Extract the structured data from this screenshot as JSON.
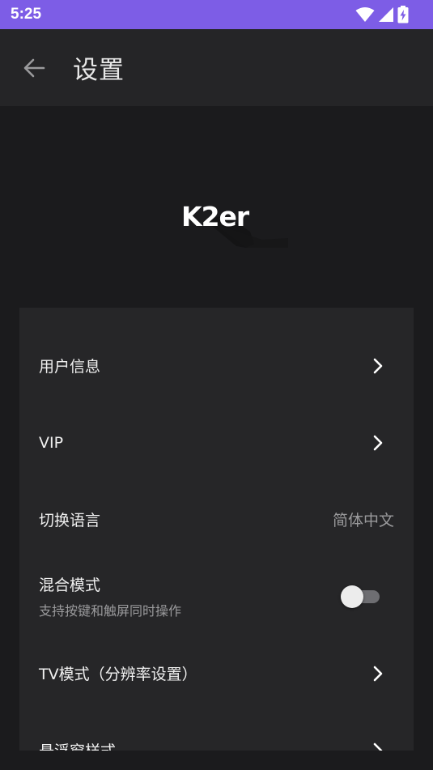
{
  "status_bar": {
    "time": "5:25"
  },
  "app_bar": {
    "title": "设置"
  },
  "logo": {
    "text": "K2er"
  },
  "settings": [
    {
      "label": "用户信息",
      "control": "chevron"
    },
    {
      "label": "VIP",
      "control": "chevron"
    },
    {
      "label": "切换语言",
      "value": "简体中文"
    },
    {
      "label": "混合模式",
      "subtitle": "支持按键和触屏同时操作",
      "control": "toggle",
      "enabled": false
    },
    {
      "label": "TV模式（分辨率设置）",
      "control": "chevron"
    },
    {
      "label": "悬浮窗样式",
      "control": "chevron"
    }
  ],
  "colors": {
    "status_bar": "#7d5de6",
    "app_bar": "#252527",
    "background": "#1b1b1d",
    "card": "#262628"
  }
}
